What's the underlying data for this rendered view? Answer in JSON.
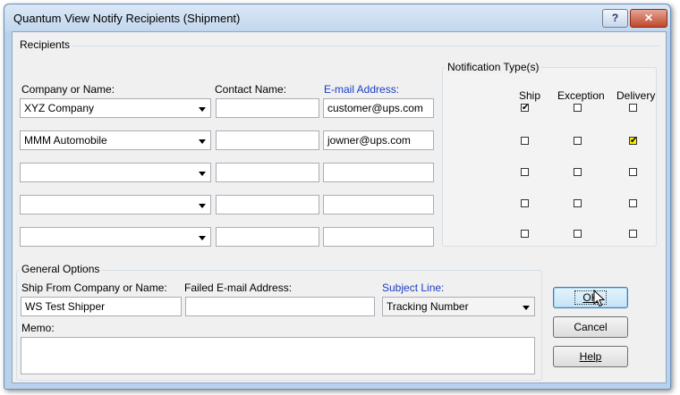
{
  "window": {
    "title": "Quantum View Notify Recipients (Shipment)",
    "help_label": "?",
    "close_label": "✕"
  },
  "recipients": {
    "group_label": "Recipients",
    "col_company": "Company or Name:",
    "col_contact": "Contact Name:",
    "col_email": "E-mail Address:",
    "rows": [
      {
        "company": "XYZ Company",
        "contact": "",
        "email": "customer@ups.com"
      },
      {
        "company": "MMM Automobile",
        "contact": "",
        "email": "jowner@ups.com"
      },
      {
        "company": "",
        "contact": "",
        "email": ""
      },
      {
        "company": "",
        "contact": "",
        "email": ""
      },
      {
        "company": "",
        "contact": "",
        "email": ""
      }
    ]
  },
  "notification": {
    "group_label": "Notification Type(s)",
    "col_ship": "Ship",
    "col_exception": "Exception",
    "col_delivery": "Delivery",
    "rows": [
      {
        "ship": true,
        "exception": false,
        "delivery": false
      },
      {
        "ship": false,
        "exception": false,
        "delivery": true
      },
      {
        "ship": false,
        "exception": false,
        "delivery": false
      },
      {
        "ship": false,
        "exception": false,
        "delivery": false
      },
      {
        "ship": false,
        "exception": false,
        "delivery": false
      }
    ],
    "check_mark": "✔"
  },
  "general": {
    "group_label": "General Options",
    "ship_from_label": "Ship From Company or Name:",
    "ship_from_value": "WS Test Shipper",
    "failed_email_label": "Failed E-mail Address:",
    "failed_email_value": "",
    "subject_label": "Subject Line:",
    "subject_value": "Tracking Number",
    "memo_label": "Memo:",
    "memo_value": ""
  },
  "buttons": {
    "ok": "OK",
    "cancel": "Cancel",
    "help": "Help"
  },
  "colors": {
    "label_blue": "#1a3cc4",
    "delivery_check_bg": "#fff000",
    "close_button": "#c0462b"
  }
}
